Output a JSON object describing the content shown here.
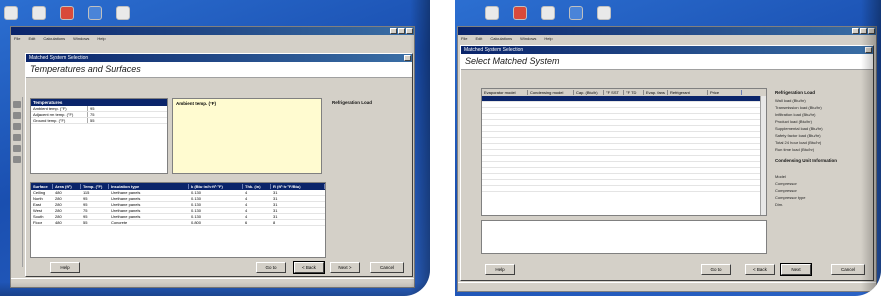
{
  "left": {
    "app_title": "",
    "menu": [
      "File",
      "Edit",
      "Calculations",
      "Windows",
      "Help"
    ],
    "dialog_caption": "Matched System Selection",
    "heading": "Temperatures and Surfaces",
    "instructions": "",
    "temps": {
      "header": "Temperatures",
      "rows": [
        {
          "label": "Ambient temp. (°F)",
          "value": "95"
        },
        {
          "label": "Adjacent rm temp. (°F)",
          "value": "75"
        },
        {
          "label": "Ground temp. (°F)",
          "value": "55"
        }
      ]
    },
    "tooltip": {
      "title": "Ambient temp. (°F)",
      "body": ""
    },
    "refrigeration_label": "Refrigeration Load",
    "refrigeration_value": "",
    "surfaces": {
      "columns": [
        "Surface",
        "Area (ft²)",
        "Temp. (°F)",
        "Insulation type",
        "k (Btu·in/h·ft²·°F)",
        "Thk. (in)",
        "R (ft²·h·°F/Btu)"
      ],
      "rows": [
        [
          "Ceiling",
          "480",
          "115",
          "Urethane panels",
          "0.130",
          "4",
          "31"
        ],
        [
          "North",
          "280",
          "95",
          "Urethane panels",
          "0.130",
          "4",
          "31"
        ],
        [
          "East",
          "280",
          "95",
          "Urethane panels",
          "0.130",
          "4",
          "31"
        ],
        [
          "West",
          "280",
          "75",
          "Urethane panels",
          "0.130",
          "4",
          "31"
        ],
        [
          "South",
          "280",
          "95",
          "Urethane panels",
          "0.130",
          "4",
          "31"
        ],
        [
          "Floor",
          "480",
          "55",
          "Concrete",
          "0.800",
          "6",
          "8"
        ]
      ]
    },
    "buttons": {
      "help": "Help",
      "goto": "Go to",
      "back": "< Back",
      "next": "Next >",
      "cancel": "Cancel"
    },
    "status": ""
  },
  "right": {
    "menu": [
      "File",
      "Edit",
      "Calculations",
      "Windows",
      "Help"
    ],
    "dialog_caption": "Matched System Selection",
    "heading": "Select Matched System",
    "instructions": "",
    "grid": {
      "columns": [
        "Evaporator model",
        "Condensing model",
        "Cap. (Btu/h)",
        "°F SST",
        "°F TD",
        "Evap. fans",
        "Refrigerant",
        "Price"
      ],
      "rows": [
        [
          "",
          "",
          "",
          "",
          "",
          "",
          "",
          ""
        ],
        [
          "",
          "",
          "",
          "",
          "",
          "",
          "",
          ""
        ],
        [
          "",
          "",
          "",
          "",
          "",
          "",
          "",
          ""
        ],
        [
          "",
          "",
          "",
          "",
          "",
          "",
          "",
          ""
        ],
        [
          "",
          "",
          "",
          "",
          "",
          "",
          "",
          ""
        ],
        [
          "",
          "",
          "",
          "",
          "",
          "",
          "",
          ""
        ],
        [
          "",
          "",
          "",
          "",
          "",
          "",
          "",
          ""
        ],
        [
          "",
          "",
          "",
          "",
          "",
          "",
          "",
          ""
        ],
        [
          "",
          "",
          "",
          "",
          "",
          "",
          "",
          ""
        ],
        [
          "",
          "",
          "",
          "",
          "",
          "",
          "",
          ""
        ],
        [
          "",
          "",
          "",
          "",
          "",
          "",
          "",
          ""
        ],
        [
          "",
          "",
          "",
          "",
          "",
          "",
          "",
          ""
        ],
        [
          "",
          "",
          "",
          "",
          "",
          "",
          "",
          ""
        ],
        [
          "",
          "",
          "",
          "",
          "",
          "",
          "",
          ""
        ],
        [
          "",
          "",
          "",
          "",
          "",
          "",
          "",
          ""
        ],
        [
          "",
          "",
          "",
          "",
          "",
          "",
          "",
          ""
        ]
      ]
    },
    "side": {
      "load_title": "Refrigeration Load",
      "load_items": [
        "Wall load (Btu/hr)",
        "Transmission load (Btu/hr)",
        "Infiltration load (Btu/hr)",
        "Product load (Btu/hr)",
        "Supplemental load (Btu/hr)",
        "Safety factor load (Btu/hr)",
        "Total 24 hour load (Btu/hr)",
        "Run time load (Btu/hr)"
      ],
      "unit_title": "Condensing Unit Information",
      "unit_items": [
        "Model",
        "Compressor",
        "Compressor",
        "Compressor type",
        "Dim."
      ]
    },
    "buttons": {
      "help": "Help",
      "goto": "Go to",
      "back": "< Back",
      "next": "Next",
      "cancel": "Cancel"
    },
    "status": ""
  }
}
